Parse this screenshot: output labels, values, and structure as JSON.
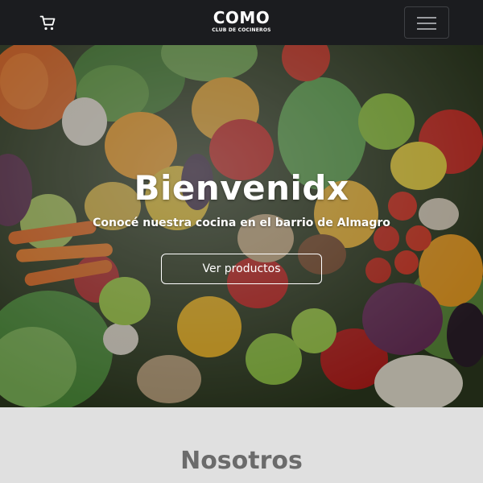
{
  "navbar": {
    "cart_icon": "shopping-cart-icon",
    "logo_text": "COMO",
    "logo_tagline": "CLUB DE COCINEROS",
    "menu_icon": "hamburger-menu-icon",
    "background": "#1b1c1f"
  },
  "hero": {
    "background_image": "assorted-vegetables-photo",
    "title": "Bienvenidx",
    "subtitle": "Conocé nuestra cocina en el barrio de Almagro",
    "cta_label": "Ver productos"
  },
  "about": {
    "title": "Nosotros",
    "background": "#e0e0e0"
  }
}
